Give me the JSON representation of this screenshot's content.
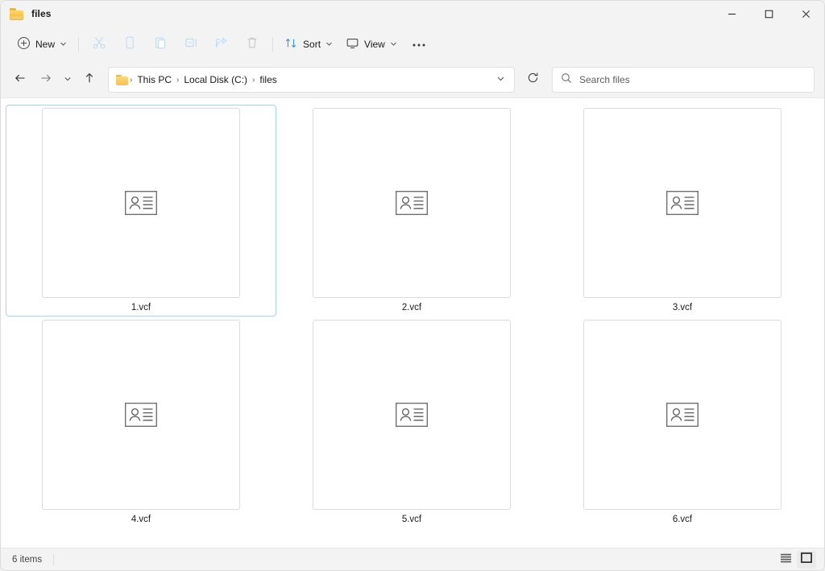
{
  "window": {
    "title": "files",
    "folder_icon": "folder-icon",
    "controls": {
      "minimize": "minimize-button",
      "maximize": "maximize-button",
      "close": "close-button"
    }
  },
  "toolbar": {
    "new_label": "New",
    "new_icon": "plus-circle-icon",
    "actions": [
      {
        "name": "cut-button",
        "icon": "scissors-icon",
        "disabled": true
      },
      {
        "name": "copy-button",
        "icon": "copy-icon",
        "disabled": true
      },
      {
        "name": "paste-button",
        "icon": "clipboard-icon",
        "disabled": true
      },
      {
        "name": "rename-button",
        "icon": "rename-icon",
        "disabled": true
      },
      {
        "name": "share-button",
        "icon": "share-icon",
        "disabled": true
      },
      {
        "name": "delete-button",
        "icon": "trash-icon",
        "disabled": true
      }
    ],
    "sort_label": "Sort",
    "sort_icon": "sort-arrows-icon",
    "view_label": "View",
    "view_icon": "monitor-icon",
    "more_label": "•••",
    "more_name": "see-more-button"
  },
  "address": {
    "back_icon": "back-arrow-icon",
    "forward_icon": "forward-arrow-icon",
    "recent_icon": "recent-locations-chevron-icon",
    "up_icon": "up-arrow-icon",
    "breadcrumb": [
      "This PC",
      "Local Disk (C:)",
      "files"
    ],
    "breadcrumb_separator": "›",
    "dropdown_icon": "address-dropdown-chevron-icon",
    "refresh_icon": "refresh-icon"
  },
  "search": {
    "placeholder": "Search files",
    "icon": "search-icon"
  },
  "files": [
    {
      "name": "1.vcf",
      "icon": "vcard-icon",
      "selected": true
    },
    {
      "name": "2.vcf",
      "icon": "vcard-icon",
      "selected": false
    },
    {
      "name": "3.vcf",
      "icon": "vcard-icon",
      "selected": false
    },
    {
      "name": "4.vcf",
      "icon": "vcard-icon",
      "selected": false
    },
    {
      "name": "5.vcf",
      "icon": "vcard-icon",
      "selected": false
    },
    {
      "name": "6.vcf",
      "icon": "vcard-icon",
      "selected": false
    }
  ],
  "statusbar": {
    "item_count": "6 items",
    "details_view_icon": "details-view-icon",
    "large-icons_view_icon": "large-icons-view-icon",
    "large_icons_view_icon": "large-icons-view-icon"
  },
  "colors": {
    "selection_border": "#a5d4f2",
    "accent_blue": "#2b88d8",
    "disabled_icon": "#c7e0f4",
    "window_bg": "#f3f3f3",
    "content_bg": "#ffffff",
    "folder_yellow": "#f3c253"
  }
}
